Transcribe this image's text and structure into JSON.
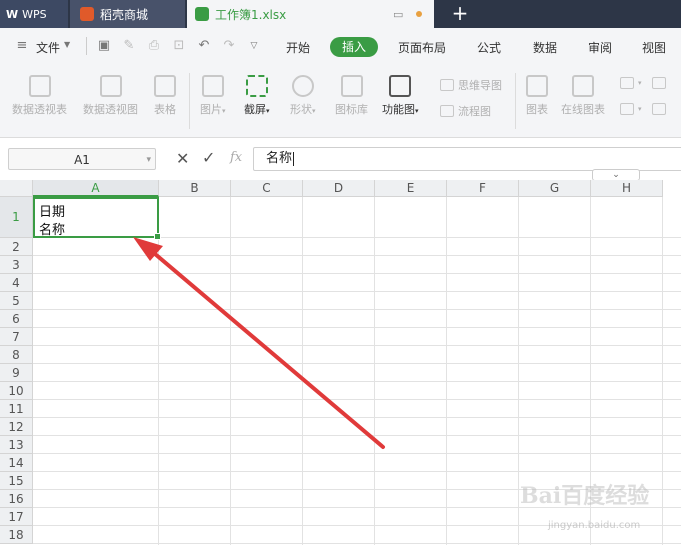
{
  "tabs": {
    "wps": "WPS",
    "daoke": "稻壳商城",
    "workbook": "工作簿1.xlsx"
  },
  "menu": {
    "file": "文件",
    "items": [
      "开始",
      "插入",
      "页面布局",
      "公式",
      "数据",
      "审阅",
      "视图"
    ],
    "active": "插入"
  },
  "ribbon": {
    "pivot_table": "数据透视表",
    "pivot_chart": "数据透视图",
    "table": "表格",
    "picture": "图片",
    "screenshot": "截屏",
    "shape": "形状",
    "icon_lib": "图标库",
    "function_chart": "功能图",
    "mind_map": "思维导图",
    "flowchart": "流程图",
    "chart": "图表",
    "online_chart": "在线图表"
  },
  "formula_bar": {
    "name_box": "A1",
    "fx": "fx",
    "content": "名称"
  },
  "grid": {
    "columns": [
      "A",
      "B",
      "C",
      "D",
      "E",
      "F",
      "G",
      "H"
    ],
    "rows": [
      "1",
      "2",
      "3",
      "4",
      "5",
      "6",
      "7",
      "8",
      "9",
      "10",
      "11",
      "12",
      "13",
      "14",
      "15",
      "16",
      "17",
      "18"
    ],
    "a1_line1": "日期",
    "a1_line2": "名称"
  },
  "colors": {
    "accent": "#3a9c44",
    "arrow": "#e03a3a"
  },
  "watermark": {
    "text": "Bai百度经验",
    "url": "jingyan.baidu.com"
  }
}
